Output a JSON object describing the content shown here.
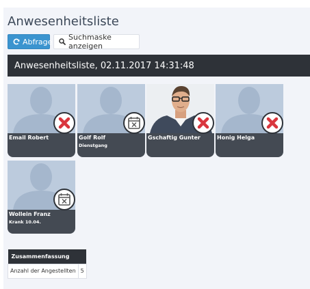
{
  "page": {
    "title": "Anwesenheitsliste"
  },
  "toolbar": {
    "query_label": "Abfrage",
    "search_mask_label": "Suchmaske anzeigen"
  },
  "header": {
    "title": "Anwesenheitsliste, 02.11.2017 14:31:48"
  },
  "employees": [
    {
      "name": "Email Robert",
      "note": "",
      "status": "absent",
      "status_icon": "red-x-icon",
      "photo": "placeholder-avatar"
    },
    {
      "name": "Golf Rolf",
      "note": "Dienstgang",
      "status": "away",
      "status_icon": "calendar-x-icon",
      "photo": "placeholder-avatar"
    },
    {
      "name": "Gschaftig Gunter",
      "note": "",
      "status": "absent",
      "status_icon": "red-x-icon",
      "photo": "portrait-photo"
    },
    {
      "name": "Honig Helga",
      "note": "",
      "status": "absent",
      "status_icon": "red-x-icon",
      "photo": "placeholder-avatar"
    },
    {
      "name": "Wollein Franz",
      "note": "Krank 10.04.",
      "status": "away",
      "status_icon": "calendar-x-icon",
      "photo": "placeholder-avatar"
    }
  ],
  "summary": {
    "heading": "Zusammenfassung",
    "rows": [
      {
        "label": "Anzahl der Angestellten",
        "value": "5"
      }
    ]
  },
  "colors": {
    "primary_button": "#3b94cf",
    "dark_bar": "#2e3238",
    "card_footer": "#444a53",
    "absent_red": "#d9363e",
    "panel_bg": "#f2f4f9"
  }
}
